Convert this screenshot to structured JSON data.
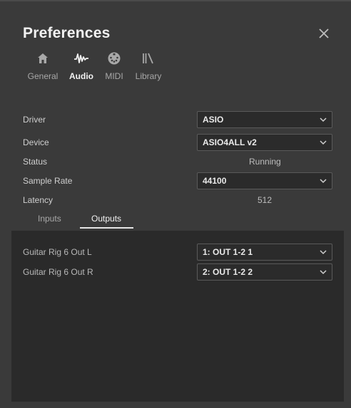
{
  "title": "Preferences",
  "tabs": [
    {
      "label": "General",
      "icon": "home-icon"
    },
    {
      "label": "Audio",
      "icon": "waveform-icon"
    },
    {
      "label": "MIDI",
      "icon": "midi-connector-icon"
    },
    {
      "label": "Library",
      "icon": "library-icon"
    }
  ],
  "active_tab": "Audio",
  "settings": {
    "driver": {
      "label": "Driver",
      "value": "ASIO"
    },
    "device": {
      "label": "Device",
      "value": "ASIO4ALL v2"
    },
    "status": {
      "label": "Status",
      "value": "Running"
    },
    "sample_rate": {
      "label": "Sample Rate",
      "value": "44100"
    },
    "latency": {
      "label": "Latency",
      "value": "512"
    }
  },
  "subtabs": [
    {
      "label": "Inputs"
    },
    {
      "label": "Outputs"
    }
  ],
  "active_subtab": "Outputs",
  "outputs": [
    {
      "label": "Guitar Rig 6 Out L",
      "value": "1: OUT 1-2 1"
    },
    {
      "label": "Guitar Rig 6 Out R",
      "value": "2: OUT 1-2 2"
    }
  ],
  "colors": {
    "background": "#3a3a3a",
    "panel": "#2a2a2a",
    "field": "#2b2b2b",
    "border": "#5a5a5a",
    "text": "#d8d8d8"
  }
}
